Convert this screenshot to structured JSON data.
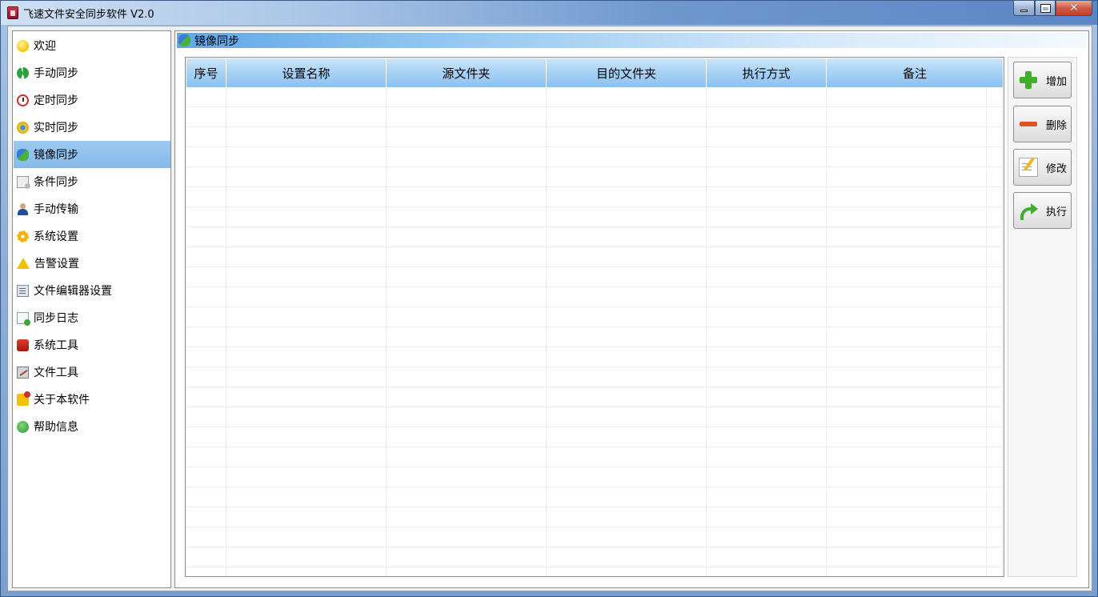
{
  "window": {
    "title": "飞速文件安全同步软件 V2.0",
    "controls": [
      "minimize",
      "maximize",
      "close"
    ]
  },
  "sidebar": {
    "items": [
      {
        "label": "欢迎",
        "icon": "smile-icon"
      },
      {
        "label": "手动同步",
        "icon": "sync-arrows-icon"
      },
      {
        "label": "定时同步",
        "icon": "clock-icon"
      },
      {
        "label": "实时同步",
        "icon": "realtime-icon"
      },
      {
        "label": "镜像同步",
        "icon": "mirror-icon",
        "active": true
      },
      {
        "label": "条件同步",
        "icon": "condition-doc-icon"
      },
      {
        "label": "手动传输",
        "icon": "user-icon"
      },
      {
        "label": "系统设置",
        "icon": "gear-icon"
      },
      {
        "label": "告警设置",
        "icon": "warning-icon"
      },
      {
        "label": "文件编辑器设置",
        "icon": "editor-icon"
      },
      {
        "label": "同步日志",
        "icon": "log-icon"
      },
      {
        "label": "系统工具",
        "icon": "toolbox-icon"
      },
      {
        "label": "文件工具",
        "icon": "file-tool-icon"
      },
      {
        "label": "关于本软件",
        "icon": "about-icon"
      },
      {
        "label": "帮助信息",
        "icon": "help-icon"
      }
    ]
  },
  "main": {
    "section_title": "镜像同步",
    "table": {
      "columns": [
        "序号",
        "设置名称",
        "源文件夹",
        "目的文件夹",
        "执行方式",
        "备注"
      ],
      "rows": []
    },
    "actions": {
      "add": "增加",
      "delete": "删除",
      "edit": "修改",
      "run": "执行"
    }
  },
  "colors": {
    "active_item": "#8ebeea",
    "header_gradient_start": "#5ea7e8",
    "table_header": "#a9d3f7",
    "add_green": "#3fae2a",
    "delete_orange": "#e0522a"
  }
}
